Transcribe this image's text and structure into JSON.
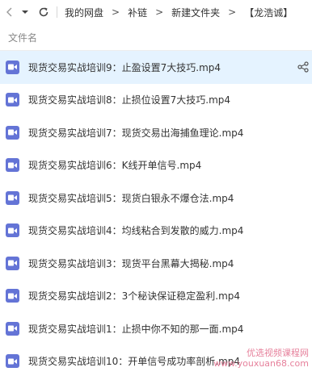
{
  "toolbar": {
    "back_icon": "chevron-left-icon",
    "forward_icon": "chevron-down-icon",
    "refresh_icon": "refresh-icon",
    "breadcrumb": [
      "我的网盘",
      "补链",
      "新建文件夹",
      "【龙浩诚】"
    ],
    "crumb_separator": ">"
  },
  "header": {
    "column_name": "文件名"
  },
  "files": [
    {
      "name": "现货交易实战培训9：止盈设置7大技巧.mp4",
      "icon": "video-file-icon",
      "selected": true
    },
    {
      "name": "现货交易实战培训8：止损位设置7大技巧.mp4",
      "icon": "video-file-icon"
    },
    {
      "name": "现货交易实战培训7：现货交易出海捕鱼理论.mp4",
      "icon": "video-file-icon"
    },
    {
      "name": "现货交易实战培训6：K线开单信号.mp4",
      "icon": "video-file-icon"
    },
    {
      "name": "现货交易实战培训5：现货白银永不爆仓法.mp4",
      "icon": "video-file-icon"
    },
    {
      "name": "现货交易实战培训4：均线粘合到发散的威力.mp4",
      "icon": "video-file-icon"
    },
    {
      "name": "现货交易实战培训3：现货平台黑幕大揭秘.mp4",
      "icon": "video-file-icon"
    },
    {
      "name": "现货交易实战培训2：3个秘诀保证稳定盈利.mp4",
      "icon": "video-file-icon"
    },
    {
      "name": "现货交易实战培训1：止损中你不知的那一面.mp4",
      "icon": "video-file-icon"
    },
    {
      "name": "现货交易实战培训10：开单信号成功率剖析.mp4",
      "icon": "video-file-icon"
    }
  ],
  "row_actions": {
    "share_icon": "share-icon"
  },
  "watermark": {
    "line1": "优选视频课程网",
    "line2": "www.youxuan68.com"
  },
  "colors": {
    "icon_bg": "#6474d6",
    "selected_bg": "#e5f3ff",
    "watermark": "#e26a8a"
  }
}
